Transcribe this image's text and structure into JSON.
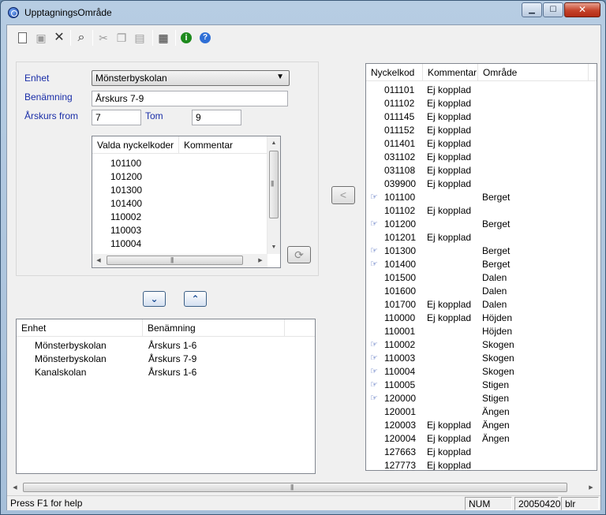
{
  "window": {
    "title": "UpptagningsOmråde",
    "minimize": "▁",
    "maximize": "☐",
    "close": "✕"
  },
  "toolbar": {
    "items": [
      "new-icon",
      "save-icon",
      "delete-icon",
      "find-icon",
      "cut-icon",
      "copy-icon",
      "paste-icon",
      "properties-icon",
      "info-icon",
      "help-icon"
    ],
    "delete_glyph": "✕",
    "find_glyph": "⌕",
    "cut_glyph": "✂",
    "copy_glyph": "❐",
    "paste_glyph": "▤",
    "properties_glyph": "▦",
    "info_glyph": "i",
    "help_glyph": "?"
  },
  "form": {
    "enhet_label": "Enhet",
    "enhet_value": "Mönsterbyskolan",
    "benamning_label": "Benämning",
    "benamning_value": "Årskurs 7-9",
    "arskurs_from_label": "Årskurs from",
    "arskurs_from_value": "7",
    "tom_label": "Tom",
    "tom_value": "9"
  },
  "selected_codes": {
    "columns": [
      "Valda nyckelkoder",
      "Kommentar"
    ],
    "rows": [
      "101100",
      "101200",
      "101300",
      "101400",
      "110002",
      "110003",
      "110004"
    ]
  },
  "units_table": {
    "columns": [
      "Enhet",
      "Benämning"
    ],
    "rows": [
      [
        "Mönsterbyskolan",
        "Årskurs 1-6"
      ],
      [
        "Mönsterbyskolan",
        "Årskurs 7-9"
      ],
      [
        "Kanalskolan",
        "Årskurs 1-6"
      ]
    ]
  },
  "codes_table": {
    "columns": [
      "Nyckelkod",
      "Kommentar",
      "Område"
    ],
    "rows": [
      {
        "linked": false,
        "code": "011101",
        "comment": "Ej kopplad",
        "area": ""
      },
      {
        "linked": false,
        "code": "011102",
        "comment": "Ej kopplad",
        "area": ""
      },
      {
        "linked": false,
        "code": "011145",
        "comment": "Ej kopplad",
        "area": ""
      },
      {
        "linked": false,
        "code": "011152",
        "comment": "Ej kopplad",
        "area": ""
      },
      {
        "linked": false,
        "code": "011401",
        "comment": "Ej kopplad",
        "area": ""
      },
      {
        "linked": false,
        "code": "031102",
        "comment": "Ej kopplad",
        "area": ""
      },
      {
        "linked": false,
        "code": "031108",
        "comment": "Ej kopplad",
        "area": ""
      },
      {
        "linked": false,
        "code": "039900",
        "comment": "Ej kopplad",
        "area": ""
      },
      {
        "linked": true,
        "code": "101100",
        "comment": "",
        "area": "Berget"
      },
      {
        "linked": false,
        "code": "101102",
        "comment": "Ej kopplad",
        "area": ""
      },
      {
        "linked": true,
        "code": "101200",
        "comment": "",
        "area": "Berget"
      },
      {
        "linked": false,
        "code": "101201",
        "comment": "Ej kopplad",
        "area": ""
      },
      {
        "linked": true,
        "code": "101300",
        "comment": "",
        "area": "Berget"
      },
      {
        "linked": true,
        "code": "101400",
        "comment": "",
        "area": "Berget"
      },
      {
        "linked": false,
        "code": "101500",
        "comment": "",
        "area": "Dalen"
      },
      {
        "linked": false,
        "code": "101600",
        "comment": "",
        "area": "Dalen"
      },
      {
        "linked": false,
        "code": "101700",
        "comment": "Ej kopplad",
        "area": "Dalen"
      },
      {
        "linked": false,
        "code": "110000",
        "comment": "Ej kopplad",
        "area": "Höjden"
      },
      {
        "linked": false,
        "code": "110001",
        "comment": "",
        "area": "Höjden"
      },
      {
        "linked": true,
        "code": "110002",
        "comment": "",
        "area": "Skogen"
      },
      {
        "linked": true,
        "code": "110003",
        "comment": "",
        "area": "Skogen"
      },
      {
        "linked": true,
        "code": "110004",
        "comment": "",
        "area": "Skogen"
      },
      {
        "linked": true,
        "code": "110005",
        "comment": "",
        "area": "Stigen"
      },
      {
        "linked": true,
        "code": "120000",
        "comment": "",
        "area": "Stigen"
      },
      {
        "linked": false,
        "code": "120001",
        "comment": "",
        "area": "Ängen"
      },
      {
        "linked": false,
        "code": "120003",
        "comment": "Ej kopplad",
        "area": "Ängen"
      },
      {
        "linked": false,
        "code": "120004",
        "comment": "Ej kopplad",
        "area": "Ängen"
      },
      {
        "linked": false,
        "code": "127663",
        "comment": "Ej kopplad",
        "area": ""
      },
      {
        "linked": false,
        "code": "127773",
        "comment": "Ej kopplad",
        "area": ""
      }
    ]
  },
  "buttons": {
    "move_left": "<",
    "move_down": "⌄",
    "move_up": "⌃",
    "refresh": "⟳"
  },
  "status": {
    "help": "Press F1 for help",
    "num": "NUM",
    "date": "20050420",
    "user": "blr"
  },
  "icons": {
    "linked": "☞",
    "combo_arrow": "▼",
    "scroll_up": "▲",
    "scroll_down": "▼",
    "scroll_left": "◀",
    "scroll_right": "▶",
    "grip": "|||"
  }
}
